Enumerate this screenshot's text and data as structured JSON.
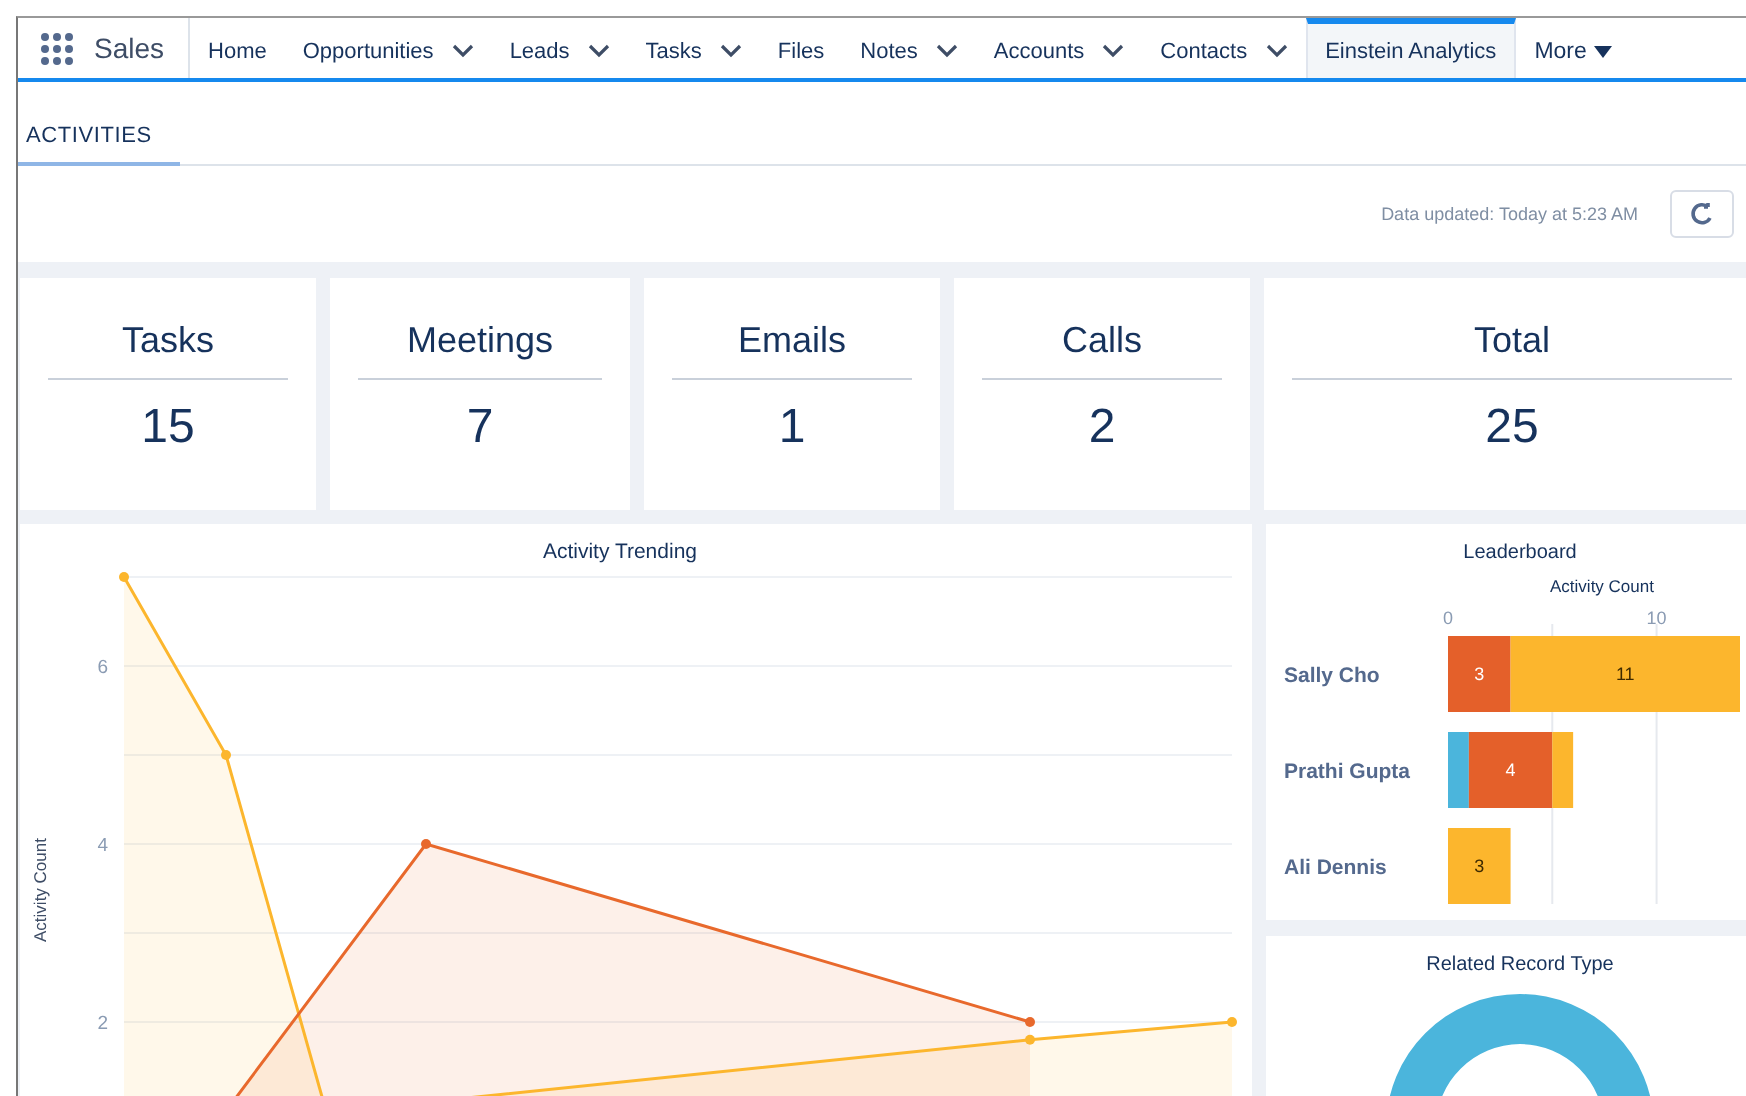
{
  "app": {
    "name": "Sales"
  },
  "nav": {
    "tabs": [
      {
        "label": "Home",
        "menu": false,
        "selected": false
      },
      {
        "label": "Opportunities",
        "menu": true,
        "selected": false
      },
      {
        "label": "Leads",
        "menu": true,
        "selected": false
      },
      {
        "label": "Tasks",
        "menu": true,
        "selected": false
      },
      {
        "label": "Files",
        "menu": false,
        "selected": false
      },
      {
        "label": "Notes",
        "menu": true,
        "selected": false
      },
      {
        "label": "Accounts",
        "menu": true,
        "selected": false
      },
      {
        "label": "Contacts",
        "menu": true,
        "selected": false
      },
      {
        "label": "Einstein Analytics",
        "menu": false,
        "selected": true
      }
    ],
    "more": {
      "label": "More"
    }
  },
  "subtabs": [
    {
      "label": "ACTIVITIES",
      "selected": true
    }
  ],
  "data_updated": "Data updated: Today at 5:23 AM",
  "kpis": [
    {
      "label": "Tasks",
      "value": "15"
    },
    {
      "label": "Meetings",
      "value": "7"
    },
    {
      "label": "Emails",
      "value": "1"
    },
    {
      "label": "Calls",
      "value": "2"
    },
    {
      "label": "Total",
      "value": "25"
    }
  ],
  "activity_trending": {
    "title": "Activity Trending",
    "ylabel": "Activity Count",
    "y_ticks": [
      "6",
      "4",
      "2"
    ]
  },
  "leaderboard": {
    "chart_data": {
      "type": "bar",
      "orientation": "horizontal",
      "stacked": true,
      "grid": true,
      "title": "Leaderboard",
      "xlabel": "Activity Count",
      "xlim": [
        0,
        14
      ],
      "xticks": [
        0,
        10
      ],
      "categories": [
        "Sally Cho",
        "Prathi Gupta",
        "Ali Dennis"
      ],
      "series": [
        {
          "color": "#4bb5dc",
          "values": [
            null,
            1,
            null
          ],
          "value_labels": [
            null,
            null,
            null
          ]
        },
        {
          "color": "#e4602a",
          "values": [
            3,
            4,
            null
          ],
          "value_labels": [
            "3",
            "4",
            null
          ]
        },
        {
          "color": "#fcb62d",
          "values": [
            11,
            1,
            3
          ],
          "value_labels": [
            "11",
            null,
            "3"
          ]
        }
      ]
    }
  },
  "related_record_type": {
    "title": "Related Record Type"
  }
}
